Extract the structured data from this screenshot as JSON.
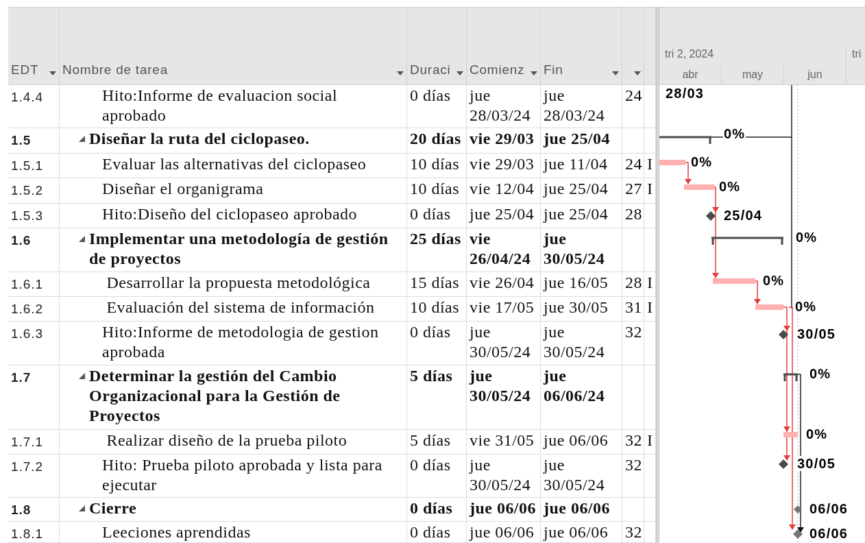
{
  "columns": [
    {
      "label": "EDT",
      "filter": true
    },
    {
      "label": "Nombre de tarea",
      "filter": true
    },
    {
      "label": "Duraci",
      "filter": true
    },
    {
      "label": "Comienz",
      "filter": true
    },
    {
      "label": "Fin",
      "filter": true
    },
    {
      "filter": true
    },
    {
      "filter": false
    }
  ],
  "timescale": {
    "quarters": [
      {
        "label": "tri 2, 2024"
      },
      {
        "label": "tri"
      }
    ],
    "months": [
      "abr",
      "may",
      "jun"
    ]
  },
  "tasks": [
    {
      "kind": "milestone",
      "edt": "1.4.4",
      "name": "Hito:Informe de evaluacion social aprobado",
      "duration": "0 días",
      "start": "jue 28/03/24",
      "finish": "jue 28/03/24",
      "predecessors": "24",
      "gantt_label": "28/03"
    },
    {
      "kind": "summary",
      "expanded": true,
      "edt": "1.5",
      "name": "Diseñar la ruta del ciclopaseo.",
      "duration": "20 días",
      "start": "vie 29/03",
      "finish": "jue 25/04",
      "gantt_label": "0%",
      "children": [
        {
          "kind": "task",
          "edt": "1.5.1",
          "name": "Evaluar las alternativas del ciclopaseo",
          "duration": "10 días",
          "start": "vie 29/03",
          "finish": "jue 11/04",
          "predecessors": "24",
          "column_7": "I",
          "gantt_label": "0%"
        },
        {
          "kind": "task",
          "edt": "1.5.2",
          "name": "Diseñar el organigrama",
          "duration": "10 días",
          "start": "vie 12/04",
          "finish": "jue 25/04",
          "predecessors": "27",
          "column_7": "I",
          "gantt_label": "0%"
        },
        {
          "kind": "milestone",
          "edt": "1.5.3",
          "name": "Hito:Diseño del ciclopaseo aprobado",
          "duration": "0 días",
          "start": "jue 25/04",
          "finish": "jue 25/04",
          "predecessors": "28",
          "gantt_label": "25/04"
        }
      ]
    },
    {
      "kind": "summary",
      "expanded": true,
      "edt": "1.6",
      "name": "Implementar una metodología de gestión de proyectos",
      "duration": "25 días",
      "start": "vie 26/04/24",
      "finish": "jue 30/05/24",
      "gantt_label": "0%",
      "children": [
        {
          "kind": "task",
          "edt": "1.6.1",
          "name": " Desarrollar la propuesta metodológica",
          "duration": "15 días",
          "start": "vie 26/04",
          "finish": "jue 16/05",
          "predecessors": "28",
          "column_7": "I",
          "gantt_label": "0%"
        },
        {
          "kind": "task",
          "edt": "1.6.2",
          "name": " Evaluación del sistema de información",
          "duration": "10 días",
          "start": "vie 17/05",
          "finish": "jue 30/05",
          "predecessors": "31",
          "column_7": "I",
          "gantt_label": "0%"
        },
        {
          "kind": "milestone",
          "edt": "1.6.3",
          "name": "Hito:Informe de metodologia de gestion aprobada",
          "duration": "0 días",
          "start": "jue 30/05/24",
          "finish": "jue 30/05/24",
          "predecessors": "32",
          "gantt_label": "30/05"
        }
      ]
    },
    {
      "kind": "summary",
      "expanded": true,
      "edt": "1.7",
      "name": "Determinar la gestión del Cambio Organizacional para la Gestión de Proyectos",
      "duration": "5 días",
      "start": "jue 30/05/24",
      "finish": "jue 06/06/24",
      "gantt_label": "0%",
      "children": [
        {
          "kind": "task",
          "edt": "1.7.1",
          "name": " Realizar diseño de la prueba piloto",
          "duration": "5 días",
          "start": "vie 31/05",
          "finish": "jue 06/06",
          "predecessors": "32",
          "column_7": "I",
          "gantt_label": "0%"
        },
        {
          "kind": "milestone",
          "edt": "1.7.2",
          "name": "Hito: Prueba piloto aprobada y lista para ejecutar",
          "duration": "0 días",
          "start": "jue 30/05/24",
          "finish": "jue 30/05/24",
          "predecessors": "32",
          "gantt_label": "30/05"
        }
      ]
    },
    {
      "kind": "summary",
      "expanded": true,
      "edt": "1.8",
      "name": "Cierre",
      "duration": "0 días",
      "start": "jue 06/06",
      "finish": "jue 06/06",
      "gantt_label": "06/06",
      "children": [
        {
          "kind": "milestone",
          "edt": "1.8.1",
          "name": "Leeciones aprendidas",
          "duration": "0 días",
          "start": "jue 06/06",
          "finish": "jue 06/06",
          "predecessors": "32",
          "gantt_label": "06/06"
        }
      ]
    }
  ]
}
